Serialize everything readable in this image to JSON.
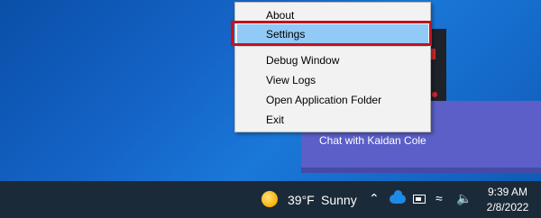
{
  "context_menu": {
    "items": [
      {
        "label": "About"
      },
      {
        "label": "Settings"
      },
      {
        "label": "Debug Window"
      },
      {
        "label": "View Logs"
      },
      {
        "label": "Open Application Folder"
      },
      {
        "label": "Exit"
      }
    ],
    "highlighted": "Settings"
  },
  "notification": {
    "text": "Chat with Kaidan Cole"
  },
  "taskbar": {
    "weather": {
      "temperature": "39°F",
      "condition": "Sunny",
      "icon": "sun-icon"
    },
    "tray_icons": [
      "chevron-up-icon",
      "onedrive-cloud-icon",
      "battery-icon",
      "wifi-icon",
      "volume-icon"
    ],
    "time": "9:39 AM",
    "date": "2/8/2022"
  },
  "colors": {
    "highlight_outline": "#c0141f",
    "menu_highlight": "#91c9f7",
    "notification_bg": "#5b5fc7",
    "taskbar_bg": "#1b2a38"
  }
}
